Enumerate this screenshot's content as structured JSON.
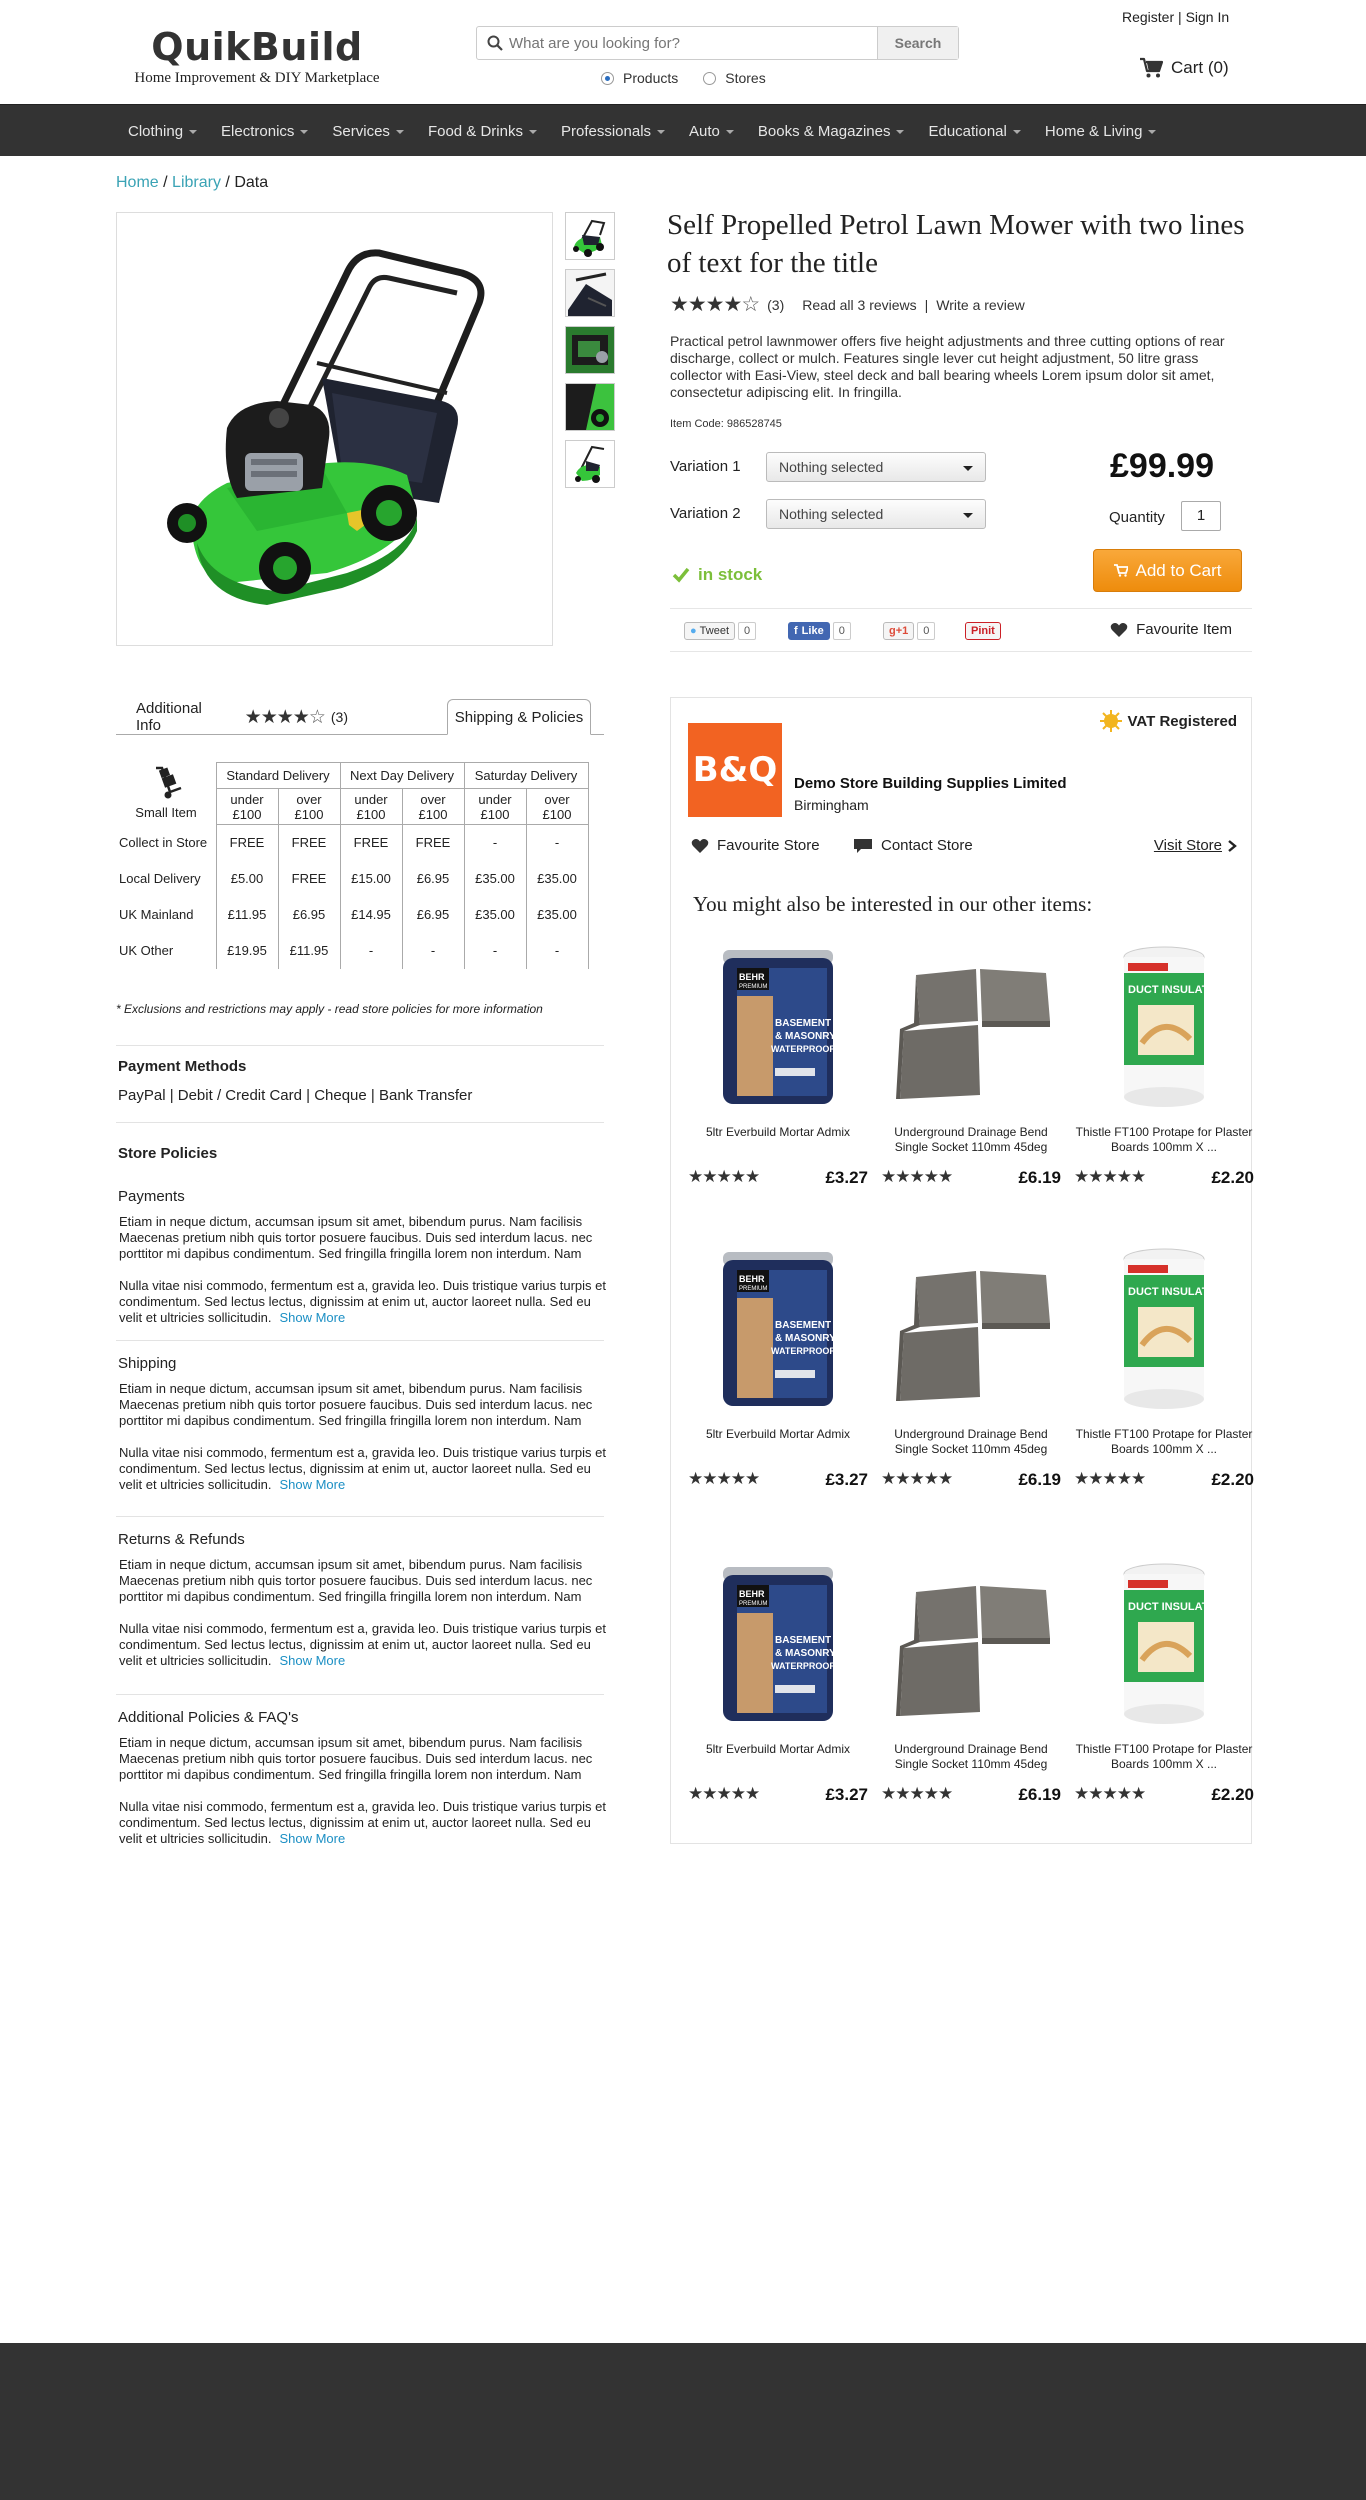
{
  "header": {
    "logo_name": "QuikBuild",
    "logo_tagline": "Home Improvement & DIY Marketplace",
    "search_placeholder": "What are you looking for?",
    "search_button": "Search",
    "radio_products": "Products",
    "radio_stores": "Stores",
    "register": "Register",
    "sign_in": "Sign In",
    "separator": "|",
    "cart_label": "Cart (0)"
  },
  "nav": [
    "Clothing",
    "Electronics",
    "Services",
    "Food & Drinks",
    "Professionals",
    "Auto",
    "Books & Magazines",
    "Educational",
    "Home & Living"
  ],
  "breadcrumb": {
    "home": "Home",
    "library": "Library",
    "current": "Data",
    "sep": "/"
  },
  "product": {
    "title": "Self Propelled Petrol Lawn Mower with two lines of text for the title",
    "rating": 4,
    "review_count": "(3)",
    "read_reviews": "Read all 3 reviews",
    "write_review": "Write a review",
    "description": "Practical petrol lawnmower offers five height adjustments and three cutting options of rear discharge, collect or mulch. Features single lever cut height adjustment, 50 litre grass collector with Easi-View, steel deck and ball bearing wheels Lorem ipsum dolor sit amet, consectetur adipiscing elit. In fringilla.",
    "item_code": "Item Code: 986528745",
    "variation1_label": "Variation 1",
    "variation2_label": "Variation 2",
    "variation_value": "Nothing selected",
    "price": "£99.99",
    "quantity_label": "Quantity",
    "quantity": "1",
    "stock": "in stock",
    "add_to_cart": "Add to Cart",
    "favourite": "Favourite Item"
  },
  "social": {
    "tweet": "Tweet",
    "tweet_count": "0",
    "like": "Like",
    "like_count": "0",
    "gplus": "+1",
    "gplus_count": "0",
    "pinit": "Pinit"
  },
  "tabs": {
    "additional_info": "Additional Info",
    "tab_rating_count": "(3)",
    "shipping": "Shipping & Policies"
  },
  "shipping": {
    "small_item": "Small Item",
    "groups": [
      "Standard Delivery",
      "Next Day Delivery",
      "Saturday Delivery"
    ],
    "sub": [
      "under\n£100",
      "over\n£100",
      "under\n£100",
      "over\n£100",
      "under\n£100",
      "over\n£100"
    ],
    "rows": [
      {
        "label": "Collect in Store",
        "values": [
          "FREE",
          "FREE",
          "FREE",
          "FREE",
          "-",
          "-"
        ]
      },
      {
        "label": "Local Delivery",
        "values": [
          "£5.00",
          "FREE",
          "£15.00",
          "£6.95",
          "£35.00",
          "£35.00"
        ]
      },
      {
        "label": "UK Mainland",
        "values": [
          "£11.95",
          "£6.95",
          "£14.95",
          "£6.95",
          "£35.00",
          "£35.00"
        ]
      },
      {
        "label": "UK Other",
        "values": [
          "£19.95",
          "£11.95",
          "-",
          "-",
          "-",
          "-"
        ]
      }
    ],
    "note": "* Exclusions and restrictions may apply - read store policies for more information"
  },
  "payment": {
    "title": "Payment Methods",
    "methods": "PayPal | Debit / Credit Card | Cheque | Bank Transfer"
  },
  "policies": {
    "title": "Store Policies",
    "show_more": "Show More",
    "para1": "Etiam in neque dictum, accumsan ipsum sit amet, bibendum purus. Nam facilisis Maecenas pretium nibh quis tortor posuere faucibus. Duis sed interdum lacus. nec porttitor mi dapibus condimentum. Sed fringilla fringilla lorem non interdum. Nam",
    "para2": "Nulla vitae nisi commodo, fermentum est a, gravida leo. Duis tristique varius turpis et condimentum. Sed lectus lectus, dignissim at enim ut, auctor laoreet nulla. Sed eu velit et ultricies sollicitudin.",
    "sections": [
      "Payments",
      "Shipping",
      "Returns & Refunds",
      "Additional Policies & FAQ's"
    ]
  },
  "store": {
    "vat": "VAT Registered",
    "logo_text": "B&Q",
    "name": "Demo Store Building Supplies Limited",
    "location": "Birmingham",
    "favourite_store": "Favourite Store",
    "contact_store": "Contact Store",
    "visit_store": "Visit Store",
    "suggest_title": "You might also be interested in our other items:"
  },
  "suggested": [
    {
      "name": "5ltr Everbuild Mortar Admix",
      "price": "£3.27",
      "rating": 5
    },
    {
      "name": "Underground Drainage Bend Single Socket 110mm 45deg",
      "price": "£6.19",
      "rating": 5
    },
    {
      "name": "Thistle FT100 Protape for Plaster Boards 100mm X ...",
      "price": "£2.20",
      "rating": 5
    },
    {
      "name": "5ltr Everbuild Mortar Admix",
      "price": "£3.27",
      "rating": 5
    },
    {
      "name": "Underground Drainage Bend Single Socket 110mm 45deg",
      "price": "£6.19",
      "rating": 5
    },
    {
      "name": "Thistle FT100 Protape for Plaster Boards 100mm X ...",
      "price": "£2.20",
      "rating": 5
    },
    {
      "name": "5ltr Everbuild Mortar Admix",
      "price": "£3.27",
      "rating": 5
    },
    {
      "name": "Underground Drainage Bend Single Socket 110mm 45deg",
      "price": "£6.19",
      "rating": 5
    },
    {
      "name": "Thistle FT100 Protape for Plaster Boards 100mm X ...",
      "price": "£2.20",
      "rating": 5
    }
  ],
  "can_labels": {
    "brand": "BEHR",
    "brand_sub": "PREMIUM",
    "line1": "BASEMENT",
    "line2": "& MASONRY",
    "line3": "WATERPROOFER"
  },
  "roll_labels": {
    "line1": "DUCT INSULATION"
  },
  "colors": {
    "accent": "#3aa3b5",
    "nav_bg": "#333333",
    "in_stock": "#7cbf3a",
    "add_to_cart": "#f39a1f",
    "store_logo": "#f26322",
    "link": "#1b8fc4"
  }
}
